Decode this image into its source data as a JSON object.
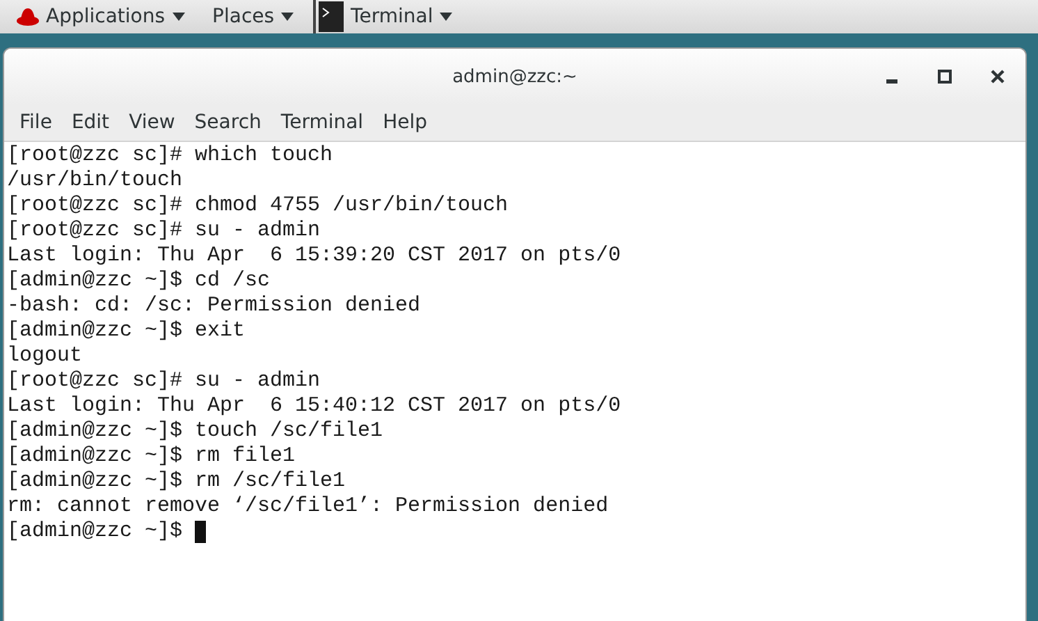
{
  "top_bar": {
    "menus": [
      {
        "label": "Applications",
        "kind": "logo"
      },
      {
        "label": "Places",
        "kind": "plain"
      }
    ],
    "task": {
      "label": "Terminal"
    }
  },
  "window": {
    "title": "admin@zzc:~"
  },
  "menu_bar": [
    "File",
    "Edit",
    "View",
    "Search",
    "Terminal",
    "Help"
  ],
  "terminal": {
    "lines": [
      "[root@zzc sc]# which touch",
      "/usr/bin/touch",
      "[root@zzc sc]# chmod 4755 /usr/bin/touch",
      "[root@zzc sc]# su - admin",
      "Last login: Thu Apr  6 15:39:20 CST 2017 on pts/0",
      "[admin@zzc ~]$ cd /sc",
      "-bash: cd: /sc: Permission denied",
      "[admin@zzc ~]$ exit",
      "logout",
      "[root@zzc sc]# su - admin",
      "Last login: Thu Apr  6 15:40:12 CST 2017 on pts/0",
      "[admin@zzc ~]$ touch /sc/file1",
      "[admin@zzc ~]$ rm file1",
      "[admin@zzc ~]$ rm /sc/file1",
      "rm: cannot remove ‘/sc/file1’: Permission denied"
    ],
    "prompt": "[admin@zzc ~]$ ",
    "cursor": true
  }
}
